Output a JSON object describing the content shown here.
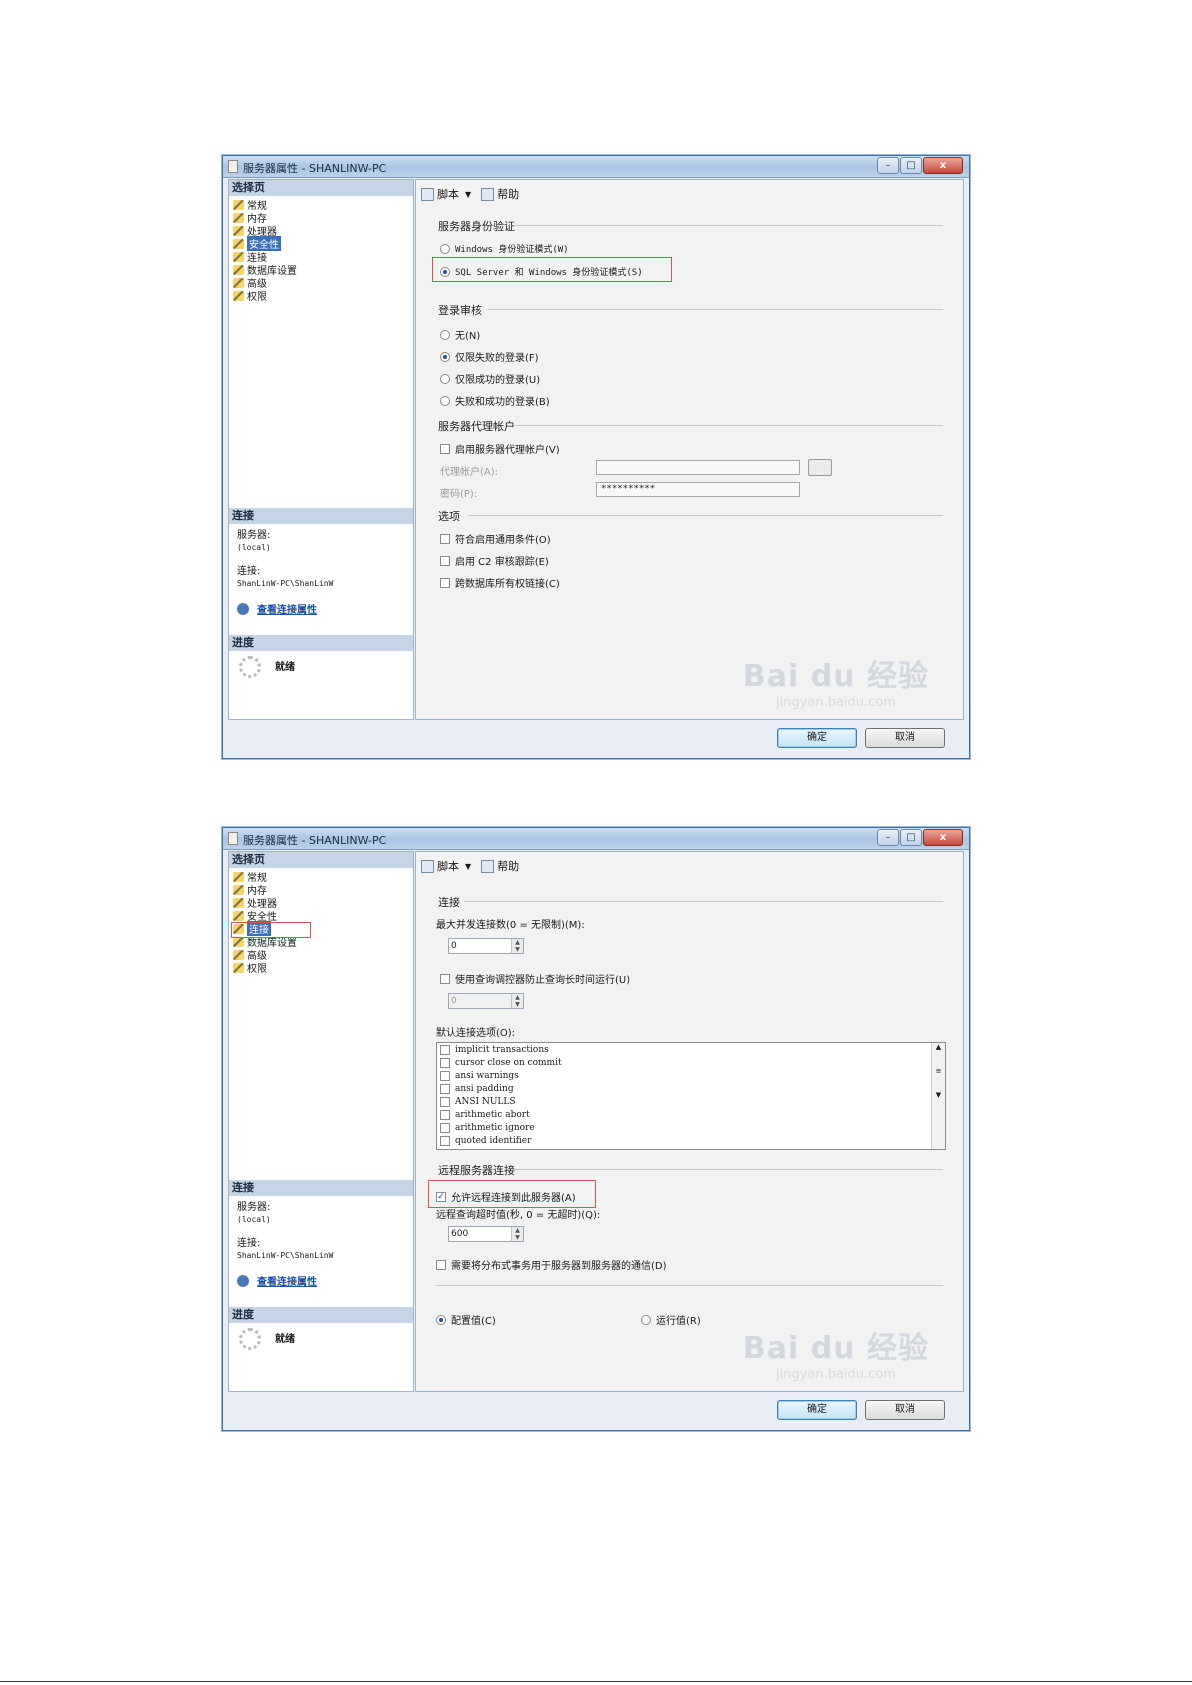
{
  "window_title": "服务器属性 - SHANLINW-PC",
  "titlebar_buttons": {
    "minimize": "–",
    "maximize": "□",
    "close": "x"
  },
  "left": {
    "select_page_header": "选择页",
    "nav_items": [
      "常规",
      "内存",
      "处理器",
      "安全性",
      "连接",
      "数据库设置",
      "高级",
      "权限"
    ],
    "connection_header": "连接",
    "server_label": "服务器:",
    "server_value": "(local)",
    "connection_label": "连接:",
    "connection_value": "ShanLinW-PC\\ShanLinW",
    "view_conn_props": "查看连接属性",
    "progress_header": "进度",
    "ready": "就绪"
  },
  "toolbar": {
    "script": "脚本",
    "help": "帮助"
  },
  "security": {
    "auth_group": "服务器身份验证",
    "auth_windows": "Windows 身份验证模式(W)",
    "auth_mixed": "SQL Server 和 Windows 身份验证模式(S)",
    "audit_group": "登录审核",
    "audit_none": "无(N)",
    "audit_failed": "仅限失败的登录(F)",
    "audit_success": "仅限成功的登录(U)",
    "audit_both": "失败和成功的登录(B)",
    "proxy_group": "服务器代理帐户",
    "proxy_enable": "启用服务器代理帐户(V)",
    "proxy_account_label": "代理帐户(A):",
    "proxy_account_value": "",
    "proxy_password_label": "密码(P):",
    "proxy_password_value": "**********",
    "options_group": "选项",
    "opt_common_criteria": "符合启用通用条件(O)",
    "opt_c2": "启用 C2 审核跟踪(E)",
    "opt_cross_db": "跨数据库所有权链接(C)"
  },
  "connections": {
    "conn_group": "连接",
    "max_conn_label": "最大并发连接数(0 = 无限制)(M):",
    "max_conn_value": "0",
    "query_governor": "使用查询调控器防止查询长时间运行(U)",
    "query_governor_value": "0",
    "default_options_label": "默认连接选项(O):",
    "default_options": [
      "implicit transactions",
      "cursor close on commit",
      "ansi warnings",
      "ansi padding",
      "ANSI NULLS",
      "arithmetic abort",
      "arithmetic ignore",
      "quoted identifier"
    ],
    "remote_group": "远程服务器连接",
    "allow_remote": "允许远程连接到此服务器(A)",
    "remote_timeout_label": "远程查询超时值(秒, 0 = 无超时)(Q):",
    "remote_timeout_value": "600",
    "require_dist_tx": "需要将分布式事务用于服务器到服务器的通信(D)",
    "configured_values": "配置值(C)",
    "running_values": "运行值(R)"
  },
  "buttons": {
    "ok": "确定",
    "cancel": "取消"
  },
  "watermark": {
    "main": "Bai du 经验",
    "sub": "jingyan.baidu.com"
  },
  "colors": {
    "highlight_box": "#d9534f",
    "selection": "#3a6fbf"
  }
}
